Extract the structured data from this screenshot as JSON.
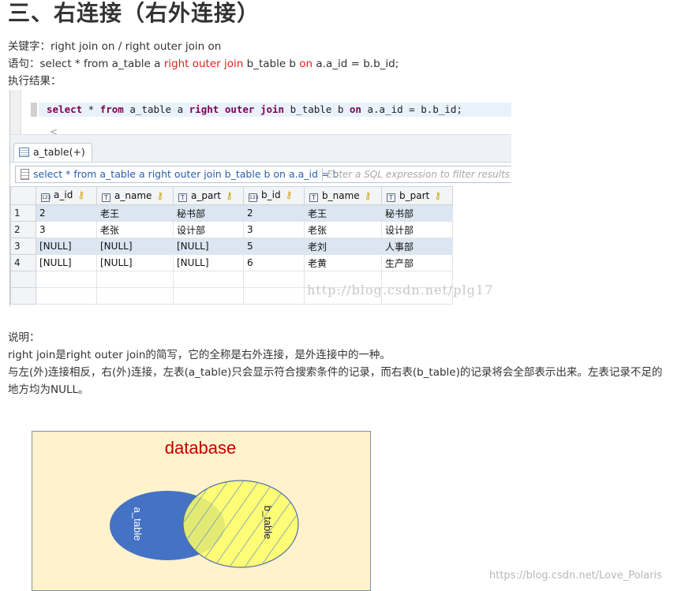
{
  "heading": "三、右连接（右外连接）",
  "intro": {
    "keyword_label": "关键字：",
    "keyword_text": "right join on / right outer join on",
    "syntax_label": "语句：",
    "syntax_before": "select * from a_table a ",
    "syntax_red1": "right outer join",
    "syntax_mid": " b_table b ",
    "syntax_red2": "on",
    "syntax_after": " a.a_id = b.b_id;",
    "result_label": "执行结果："
  },
  "editor": {
    "kw_select": "select",
    "sql_part1": " * ",
    "kw_from": "from",
    "sql_part2": " a_table a ",
    "kw_right": "right",
    "sql_part3": " ",
    "kw_outer": "outer",
    "sql_part4": " ",
    "kw_join": "join",
    "sql_part5": " b_table b ",
    "kw_on": "on",
    "sql_part6": " a.a_id = b.b_id;",
    "scroll_arrow": "<"
  },
  "result_tab": {
    "label": "a_table(+)"
  },
  "filter": {
    "query": "select * from a_table a right outer join b_table b on a.a_id = b",
    "placeholder": "Enter a SQL expression to filter results (u"
  },
  "grid": {
    "columns": [
      {
        "name": "a_id",
        "icon_glyph": "123"
      },
      {
        "name": "a_name",
        "icon_glyph": "T"
      },
      {
        "name": "a_part",
        "icon_glyph": "T"
      },
      {
        "name": "b_id",
        "icon_glyph": "123"
      },
      {
        "name": "b_name",
        "icon_glyph": "T"
      },
      {
        "name": "b_part",
        "icon_glyph": "T"
      }
    ],
    "rows": [
      {
        "num": "1",
        "cells": [
          "2",
          "老王",
          "秘书部",
          "2",
          "老王",
          "秘书部"
        ]
      },
      {
        "num": "2",
        "cells": [
          "3",
          "老张",
          "设计部",
          "3",
          "老张",
          "设计部"
        ]
      },
      {
        "num": "3",
        "cells": [
          "[NULL]",
          "[NULL]",
          "[NULL]",
          "5",
          "老刘",
          "人事部"
        ]
      },
      {
        "num": "4",
        "cells": [
          "[NULL]",
          "[NULL]",
          "[NULL]",
          "6",
          "老黄",
          "生产部"
        ]
      }
    ],
    "watermark": "http://blog.csdn.net/plg17"
  },
  "explanation": {
    "label": "说明：",
    "line1": "right join是right outer join的简写，它的全称是右外连接，是外连接中的一种。",
    "line2": "与左(外)连接相反，右(外)连接，左表(a_table)只会显示符合搜索条件的记录，而右表(b_table)的记录将会全部表示出来。左表记录不足的",
    "line3": "地方均为NULL。"
  },
  "venn": {
    "title": "database",
    "left_label": "a_table",
    "right_label": "b_table",
    "colors": {
      "background": "#fff2cc",
      "left": "#4472c4",
      "right": "#ffff66",
      "title": "#c00000"
    }
  },
  "page_watermark": "https://blog.csdn.net/Love_Polaris"
}
